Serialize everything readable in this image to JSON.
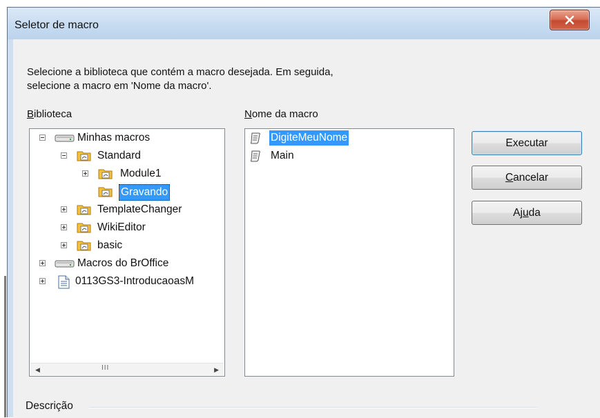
{
  "window": {
    "title": "Seletor de macro"
  },
  "instruction": {
    "line1": "Selecione a biblioteca que contém a macro desejada. Em seguida,",
    "line2": "selecione a macro em 'Nome da macro'."
  },
  "library": {
    "label_accel": "B",
    "label_rest": "iblioteca",
    "tree": [
      {
        "label": "Minhas macros",
        "icon": "drive-icon",
        "expanded": true
      },
      {
        "label": "Standard",
        "icon": "library-folder-icon",
        "expanded": true
      },
      {
        "label": "Module1",
        "icon": "module-folder-icon",
        "expanded": false
      },
      {
        "label": "Gravando",
        "icon": "module-folder-icon",
        "selected": true
      },
      {
        "label": "TemplateChanger",
        "icon": "library-folder-icon",
        "expanded": false
      },
      {
        "label": "WikiEditor",
        "icon": "library-folder-icon",
        "expanded": false
      },
      {
        "label": "basic",
        "icon": "library-folder-icon",
        "expanded": false
      },
      {
        "label": "Macros do BrOffice",
        "icon": "drive-icon",
        "expanded": false
      },
      {
        "label": "0113GS3-IntroducaoasM",
        "icon": "document-icon",
        "expanded": false
      }
    ]
  },
  "macros": {
    "label_accel": "N",
    "label_rest": "ome da macro",
    "items": [
      {
        "label": "DigiteMeuNome",
        "icon": "macro-scroll-icon",
        "selected": true
      },
      {
        "label": "Main",
        "icon": "macro-scroll-icon",
        "selected": false
      }
    ]
  },
  "buttons": {
    "run": "Executar",
    "cancel_accel": "C",
    "cancel_rest": "ancelar",
    "help_pre": "Aj",
    "help_accel": "u",
    "help_rest": "da"
  },
  "description": {
    "label": "Descrição"
  },
  "colors": {
    "selection": "#3399ff",
    "close_button": "#c44a2f",
    "title_bar": "#c7dcf1"
  }
}
